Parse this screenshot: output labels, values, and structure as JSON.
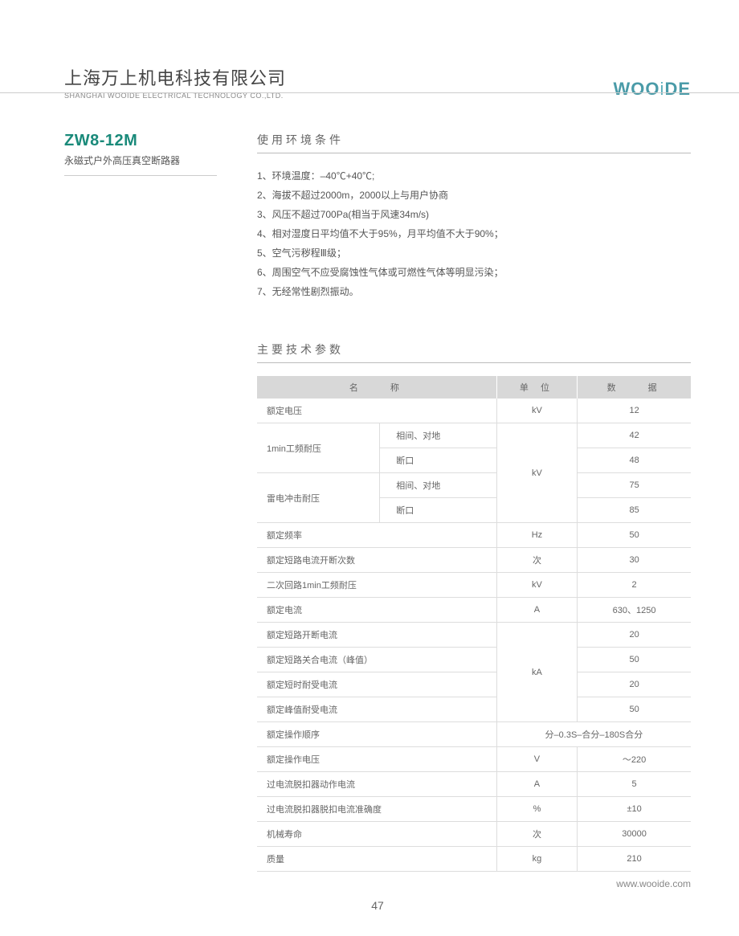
{
  "header": {
    "company_cn": "上海万上机电科技有限公司",
    "company_en": "SHANGHAI WOOIDE ELECTRICAL TECHNOLOGY CO.,LTD.",
    "logo_1": "WOO",
    "logo_i": "i",
    "logo_2": "DE"
  },
  "product": {
    "model": "ZW8-12M",
    "subtitle": "永磁式户外高压真空断路器"
  },
  "section1": {
    "title": "使用环境条件",
    "items": [
      "1、环境温度：–40℃+40℃;",
      "2、海拔不超过2000m，2000以上与用户协商",
      "3、风压不超过700Pa(相当于风速34m/s)",
      "4、相对湿度日平均值不大于95%，月平均值不大于90%；",
      "5、空气污秽程Ⅲ级；",
      "6、周围空气不应受腐蚀性气体或可燃性气体等明显污染；",
      "7、无经常性剧烈振动。"
    ]
  },
  "section2": {
    "title": "主要技术参数",
    "headers": {
      "name": "名　　称",
      "unit": "单 位",
      "data": "数　　据"
    },
    "rows": {
      "r1": {
        "name": "额定电压",
        "unit": "kV",
        "data": "12"
      },
      "r2": {
        "name": "1min工频耐压",
        "sub1": "相间、对地",
        "sub2": "断口",
        "d1": "42",
        "d2": "48"
      },
      "r3": {
        "name": "雷电冲击耐压",
        "sub1": "相间、对地",
        "sub2": "断口",
        "d1": "75",
        "d2": "85"
      },
      "unit_kv": "kV",
      "r4": {
        "name": "额定频率",
        "unit": "Hz",
        "data": "50"
      },
      "r5": {
        "name": "额定短路电流开断次数",
        "unit": "次",
        "data": "30"
      },
      "r6": {
        "name": "二次回路1min工频耐压",
        "unit": "kV",
        "data": "2"
      },
      "r7": {
        "name": "额定电流",
        "unit": "A",
        "data": "630、1250"
      },
      "r8": {
        "name": "额定短路开断电流",
        "data": "20"
      },
      "r9": {
        "name": "额定短路关合电流（峰值）",
        "data": "50"
      },
      "r10": {
        "name": "额定短时耐受电流",
        "data": "20"
      },
      "r11": {
        "name": "额定峰值耐受电流",
        "data": "50"
      },
      "unit_ka": "kA",
      "r12": {
        "name": "额定操作顺序",
        "data": "分–0.3S–合分–180S合分"
      },
      "r13": {
        "name": "额定操作电压",
        "unit": "V",
        "data": "～220"
      },
      "r14": {
        "name": "过电流脱扣器动作电流",
        "unit": "A",
        "data": "5"
      },
      "r15": {
        "name": "过电流脱扣器脱扣电流准确度",
        "unit": "%",
        "data": "±10"
      },
      "r16": {
        "name": "机械寿命",
        "unit": "次",
        "data": "30000"
      },
      "r17": {
        "name": "质量",
        "unit": "kg",
        "data": "210"
      }
    }
  },
  "footer": {
    "url": "www.wooide.com",
    "page": "47"
  }
}
